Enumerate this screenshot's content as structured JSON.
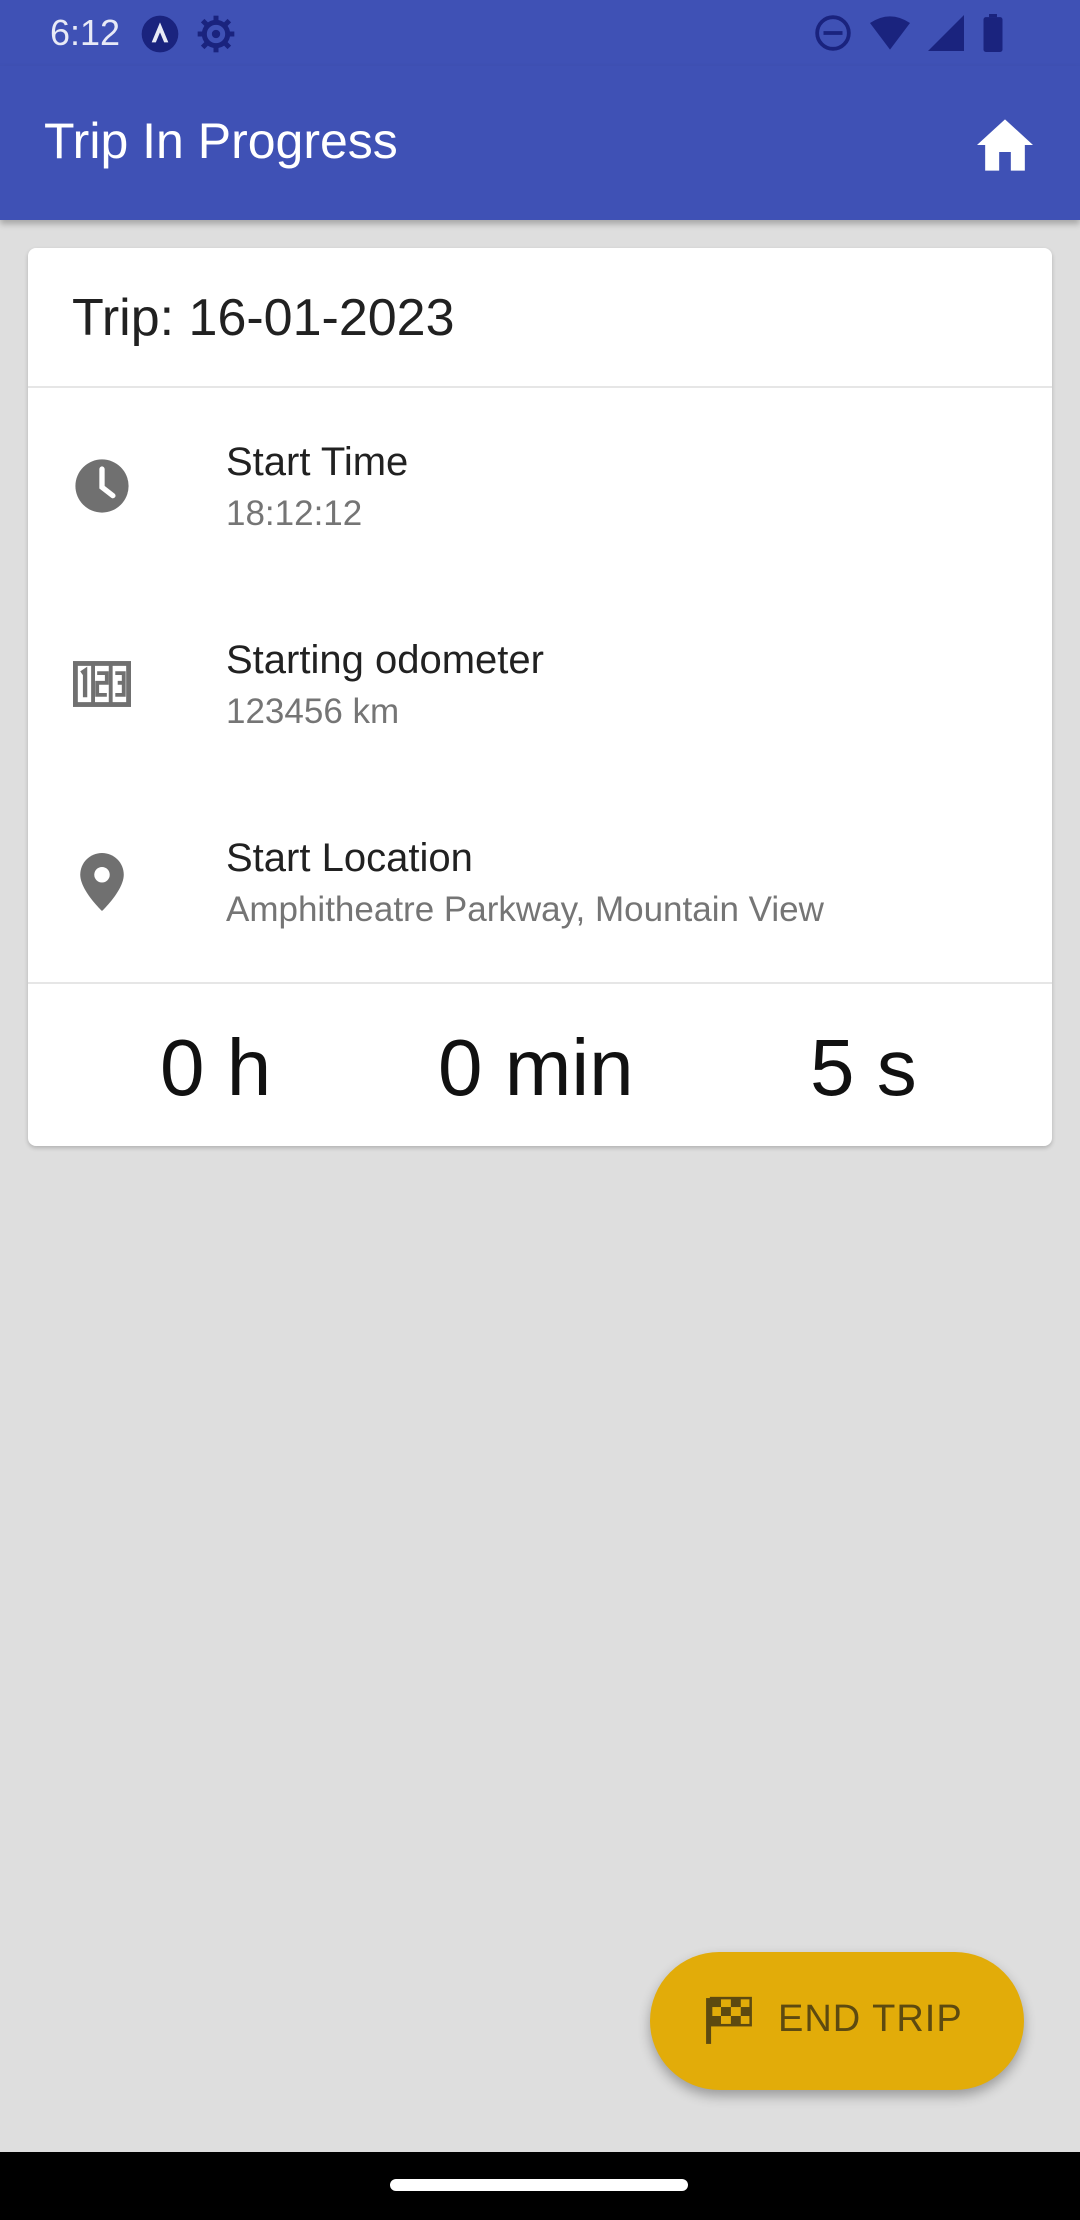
{
  "status_bar": {
    "time": "6:12",
    "left_icons": [
      "assistant-icon",
      "settings-gear-icon"
    ],
    "right_icons": [
      "do-not-disturb-icon",
      "wifi-icon",
      "signal-icon",
      "battery-icon"
    ]
  },
  "app_bar": {
    "title": "Trip In Progress",
    "home_icon": "home-icon",
    "background_color": "#3f51b5"
  },
  "trip": {
    "title": "Trip: 16-01-2023",
    "rows": [
      {
        "icon": "clock-icon",
        "label": "Start Time",
        "value": "18:12:12"
      },
      {
        "icon": "odometer-icon",
        "label": "Starting odometer",
        "value": "123456 km"
      },
      {
        "icon": "location-pin-icon",
        "label": "Start Location",
        "value": "Amphitheatre Parkway, Mountain View"
      }
    ],
    "timer": {
      "hours": "0 h",
      "minutes": "0 min",
      "seconds": "5 s"
    }
  },
  "fab": {
    "label": "END TRIP",
    "icon": "checkered-flag-icon",
    "color": "#e2ac09"
  }
}
